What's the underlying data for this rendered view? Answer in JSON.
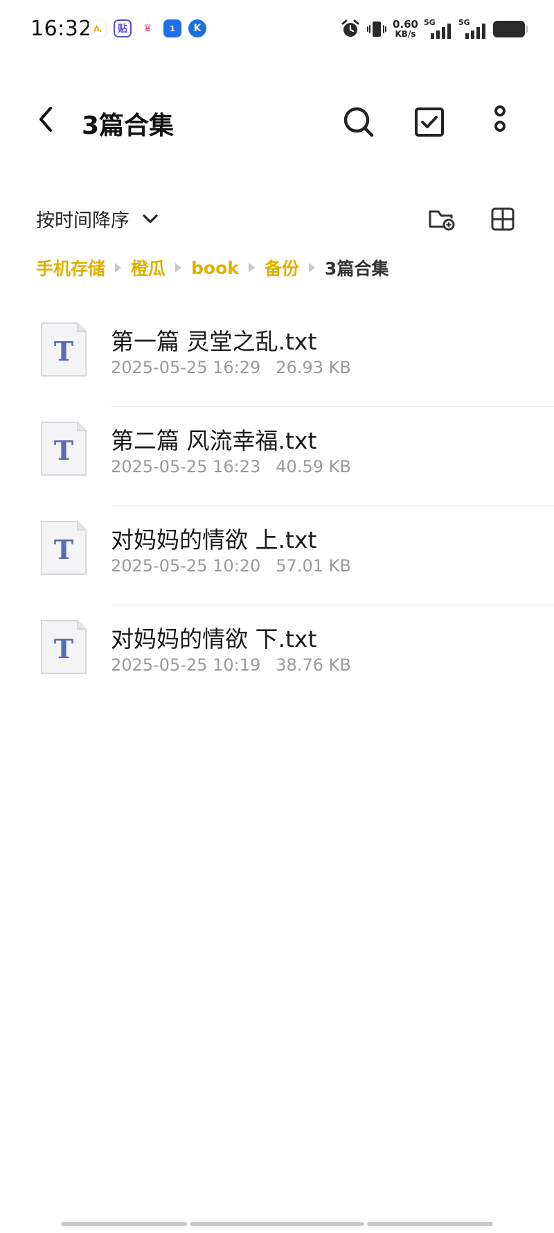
{
  "status_bar": {
    "time": "16:32",
    "net_speed_value": "0.60",
    "net_speed_unit": "KB/s",
    "signal1_label": "5G",
    "signal2_label": "5G",
    "notification_icons": [
      "tasks-app-icon",
      "tieba-app-icon",
      "crown-app-icon",
      "hotspot-app-icon",
      "k-app-icon"
    ],
    "notif_texts": [
      "ሊ",
      "贴",
      "♛",
      "1",
      "K"
    ]
  },
  "app_bar": {
    "title": "3篇合集"
  },
  "sort": {
    "label": "按时间降序"
  },
  "breadcrumb": [
    {
      "label": "手机存储"
    },
    {
      "label": "橙瓜"
    },
    {
      "label": "book"
    },
    {
      "label": "备份"
    },
    {
      "label": "3篇合集"
    }
  ],
  "files": [
    {
      "name": "第一篇  灵堂之乱.txt",
      "date": "2025-05-25 16:29",
      "size": "26.93 KB"
    },
    {
      "name": "第二篇 风流幸福.txt",
      "date": "2025-05-25 16:23",
      "size": "40.59 KB"
    },
    {
      "name": "对妈妈的情欲 上.txt",
      "date": "2025-05-25 10:20",
      "size": "57.01 KB"
    },
    {
      "name": "对妈妈的情欲 下.txt",
      "date": "2025-05-25 10:19",
      "size": "38.76 KB"
    }
  ],
  "file_icon_letter": "T",
  "colors": {
    "accent": "#e0b000",
    "icon_letter": "#5a6bb0"
  }
}
